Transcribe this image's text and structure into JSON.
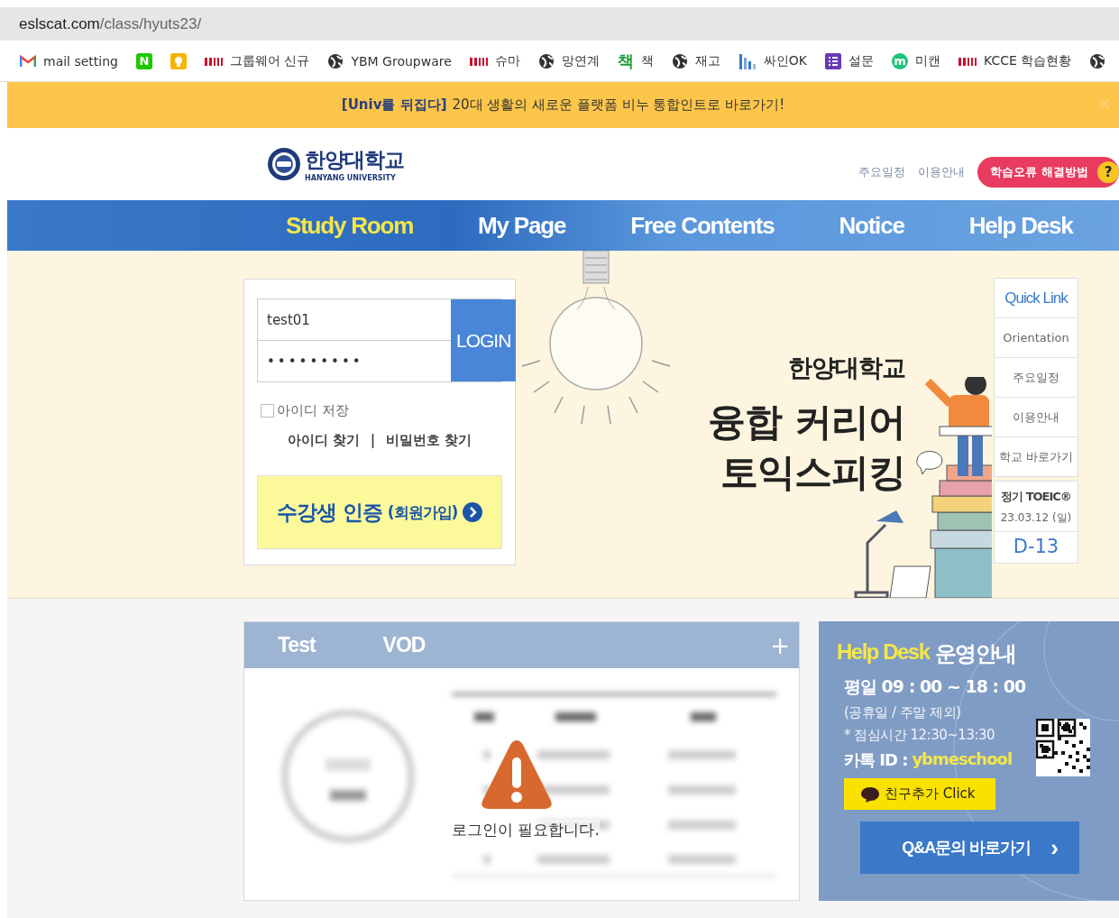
{
  "address_bar": {
    "host": "eslscat.com",
    "path": "/class/hyuts23/"
  },
  "bookmarks": [
    {
      "kind": "mail",
      "label": "mail setting"
    },
    {
      "kind": "letter",
      "icon_text": "N",
      "color": "#1ec800"
    },
    {
      "kind": "bulb"
    },
    {
      "kind": "ybm",
      "label": "그룹웨어 신규"
    },
    {
      "kind": "globe",
      "label": "YBM Groupware"
    },
    {
      "kind": "ybm",
      "label": "슈마"
    },
    {
      "kind": "globe",
      "label": "망연계"
    },
    {
      "kind": "glyph",
      "icon_text": "책",
      "label": "책",
      "color": "#1a9e3a"
    },
    {
      "kind": "globe",
      "label": "재고"
    },
    {
      "kind": "bars",
      "label": "싸인OK"
    },
    {
      "kind": "form",
      "label": "설문"
    },
    {
      "kind": "letter",
      "icon_text": "m",
      "label": "미캔",
      "color": "#1cc47a"
    },
    {
      "kind": "ybm",
      "label": "KCCE 학습현황"
    },
    {
      "kind": "globe"
    }
  ],
  "banner": {
    "tag": "[Univ를 뒤집다]",
    "text": "20대 생활의 새로운 플랫폼 비누 통합인트로 바로가기!"
  },
  "header": {
    "logo_name": "한양대학교",
    "logo_sub": "HANYANG UNIVERSITY",
    "links": [
      "주요일정",
      "이용안내"
    ],
    "help_button": "학습오류 해결방법",
    "help_icon": "?"
  },
  "nav": [
    {
      "label": "Study Room",
      "selected": true
    },
    {
      "label": "My Page",
      "selected": false
    },
    {
      "label": "Free Contents",
      "selected": false
    },
    {
      "label": "Notice",
      "selected": false
    },
    {
      "label": "Help Desk",
      "selected": false
    }
  ],
  "login": {
    "id_value": "test01",
    "password_mask": "•••••••••",
    "button": "LOGIN",
    "remember": {
      "label": "아이디 저장",
      "checked": false
    },
    "find_links": [
      "아이디 찾기",
      "비밀번호 찾기"
    ],
    "separator": "|",
    "signup": {
      "main": "수강생 인증",
      "sub": "(회원가입)"
    }
  },
  "hero": {
    "school": "한양대학교",
    "title_lines": [
      "융합 커리어",
      "토익스피킹"
    ]
  },
  "quick_link": {
    "title": "Quick Link",
    "items": [
      "Orientation",
      "주요일정",
      "이용안내",
      "학교 바로가기"
    ],
    "exam": {
      "title": "정기 TOEIC®",
      "date": "23.03.12 (일)",
      "dday": "D-13"
    }
  },
  "course_card": {
    "tabs": [
      "Test",
      "VOD"
    ],
    "more": "+",
    "notice": "로그인이 필요합니다."
  },
  "help_desk": {
    "title_highlight": "Help Desk",
    "title": "운영안내",
    "hours": "평일 09 : 00 ~ 18 : 00",
    "note": "(공휴일 / 주말 제외)",
    "lunch": "* 점심시간 12:30~13:30",
    "kakao_label": "카톡 ID :",
    "kakao_id": "ybmeschool",
    "friend_button": "친구추가 Click",
    "qa_button": "Q&A문의 바로가기",
    "qa_arrow": "›"
  }
}
